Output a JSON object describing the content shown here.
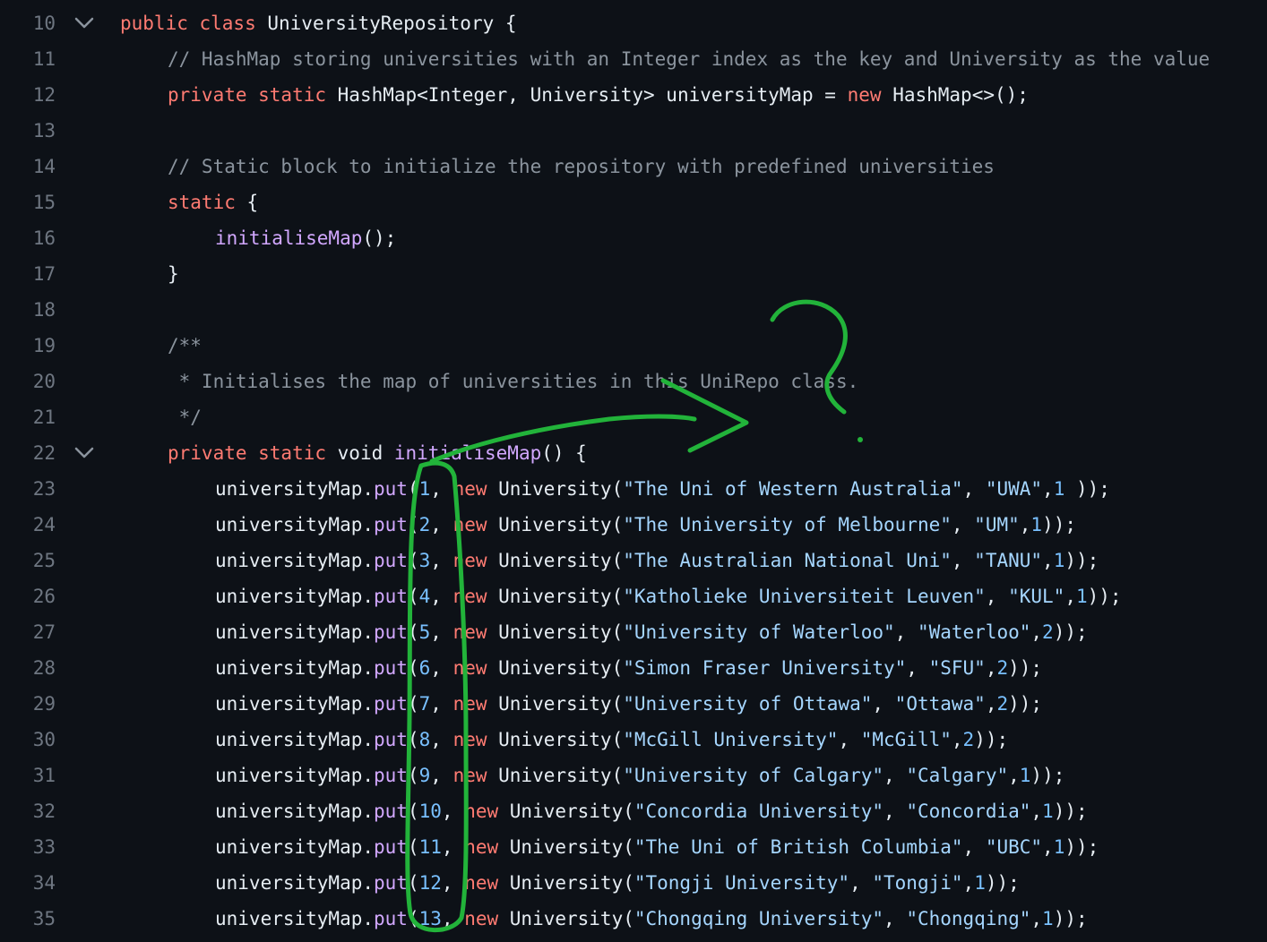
{
  "lines": [
    {
      "n": "10",
      "fold": true,
      "indent": 0,
      "tokens": [
        [
          "kw",
          "public class "
        ],
        [
          "pl",
          "UniversityRepository {"
        ]
      ]
    },
    {
      "n": "11",
      "indent": 1,
      "tokens": [
        [
          "cm",
          "// HashMap storing universities with an Integer index as the key and University as the value"
        ]
      ]
    },
    {
      "n": "12",
      "indent": 1,
      "tokens": [
        [
          "kw",
          "private static "
        ],
        [
          "pl",
          "HashMap<Integer, University> universityMap = "
        ],
        [
          "kw",
          "new "
        ],
        [
          "pl",
          "HashMap<>();"
        ]
      ]
    },
    {
      "n": "13",
      "indent": 0,
      "tokens": []
    },
    {
      "n": "14",
      "indent": 1,
      "tokens": [
        [
          "cm",
          "// Static block to initialize the repository with predefined universities"
        ]
      ]
    },
    {
      "n": "15",
      "indent": 1,
      "tokens": [
        [
          "kw",
          "static "
        ],
        [
          "pl",
          "{"
        ]
      ]
    },
    {
      "n": "16",
      "indent": 2,
      "tokens": [
        [
          "fn",
          "initialiseMap"
        ],
        [
          "pl",
          "();"
        ]
      ]
    },
    {
      "n": "17",
      "indent": 1,
      "tokens": [
        [
          "pl",
          "}"
        ]
      ]
    },
    {
      "n": "18",
      "indent": 0,
      "tokens": []
    },
    {
      "n": "19",
      "indent": 1,
      "tokens": [
        [
          "cm",
          "/**"
        ]
      ]
    },
    {
      "n": "20",
      "indent": 1,
      "tokens": [
        [
          "cm",
          " * Initialises the map of universities in this UniRepo class."
        ]
      ]
    },
    {
      "n": "21",
      "indent": 1,
      "tokens": [
        [
          "cm",
          " */"
        ]
      ]
    },
    {
      "n": "22",
      "fold": true,
      "indent": 1,
      "tokens": [
        [
          "kw",
          "private static "
        ],
        [
          "pl",
          "void "
        ],
        [
          "fn",
          "initialiseMap"
        ],
        [
          "pl",
          "() {"
        ]
      ]
    },
    {
      "n": "23",
      "indent": 2,
      "tokens": [
        [
          "pl",
          "universityMap."
        ],
        [
          "fn",
          "put"
        ],
        [
          "pl",
          "("
        ],
        [
          "nm",
          "1"
        ],
        [
          "pl",
          ", "
        ],
        [
          "kw",
          "new "
        ],
        [
          "pl",
          "University("
        ],
        [
          "st",
          "\"The Uni of Western Australia\""
        ],
        [
          "pl",
          ", "
        ],
        [
          "st",
          "\"UWA\""
        ],
        [
          "pl",
          ","
        ],
        [
          "nm",
          "1"
        ],
        [
          "pl",
          " ));"
        ]
      ]
    },
    {
      "n": "24",
      "indent": 2,
      "tokens": [
        [
          "pl",
          "universityMap."
        ],
        [
          "fn",
          "put"
        ],
        [
          "pl",
          "("
        ],
        [
          "nm",
          "2"
        ],
        [
          "pl",
          ", "
        ],
        [
          "kw",
          "new "
        ],
        [
          "pl",
          "University("
        ],
        [
          "st",
          "\"The University of Melbourne\""
        ],
        [
          "pl",
          ", "
        ],
        [
          "st",
          "\"UM\""
        ],
        [
          "pl",
          ","
        ],
        [
          "nm",
          "1"
        ],
        [
          "pl",
          "));"
        ]
      ]
    },
    {
      "n": "25",
      "indent": 2,
      "tokens": [
        [
          "pl",
          "universityMap."
        ],
        [
          "fn",
          "put"
        ],
        [
          "pl",
          "("
        ],
        [
          "nm",
          "3"
        ],
        [
          "pl",
          ", "
        ],
        [
          "kw",
          "new "
        ],
        [
          "pl",
          "University("
        ],
        [
          "st",
          "\"The Australian National Uni\""
        ],
        [
          "pl",
          ", "
        ],
        [
          "st",
          "\"TANU\""
        ],
        [
          "pl",
          ","
        ],
        [
          "nm",
          "1"
        ],
        [
          "pl",
          "));"
        ]
      ]
    },
    {
      "n": "26",
      "indent": 2,
      "tokens": [
        [
          "pl",
          "universityMap."
        ],
        [
          "fn",
          "put"
        ],
        [
          "pl",
          "("
        ],
        [
          "nm",
          "4"
        ],
        [
          "pl",
          ", "
        ],
        [
          "kw",
          "new "
        ],
        [
          "pl",
          "University("
        ],
        [
          "st",
          "\"Katholieke Universiteit Leuven\""
        ],
        [
          "pl",
          ", "
        ],
        [
          "st",
          "\"KUL\""
        ],
        [
          "pl",
          ","
        ],
        [
          "nm",
          "1"
        ],
        [
          "pl",
          "));"
        ]
      ]
    },
    {
      "n": "27",
      "indent": 2,
      "tokens": [
        [
          "pl",
          "universityMap."
        ],
        [
          "fn",
          "put"
        ],
        [
          "pl",
          "("
        ],
        [
          "nm",
          "5"
        ],
        [
          "pl",
          ", "
        ],
        [
          "kw",
          "new "
        ],
        [
          "pl",
          "University("
        ],
        [
          "st",
          "\"University of Waterloo\""
        ],
        [
          "pl",
          ", "
        ],
        [
          "st",
          "\"Waterloo\""
        ],
        [
          "pl",
          ","
        ],
        [
          "nm",
          "2"
        ],
        [
          "pl",
          "));"
        ]
      ]
    },
    {
      "n": "28",
      "indent": 2,
      "tokens": [
        [
          "pl",
          "universityMap."
        ],
        [
          "fn",
          "put"
        ],
        [
          "pl",
          "("
        ],
        [
          "nm",
          "6"
        ],
        [
          "pl",
          ", "
        ],
        [
          "kw",
          "new "
        ],
        [
          "pl",
          "University("
        ],
        [
          "st",
          "\"Simon Fraser University\""
        ],
        [
          "pl",
          ", "
        ],
        [
          "st",
          "\"SFU\""
        ],
        [
          "pl",
          ","
        ],
        [
          "nm",
          "2"
        ],
        [
          "pl",
          "));"
        ]
      ]
    },
    {
      "n": "29",
      "indent": 2,
      "tokens": [
        [
          "pl",
          "universityMap."
        ],
        [
          "fn",
          "put"
        ],
        [
          "pl",
          "("
        ],
        [
          "nm",
          "7"
        ],
        [
          "pl",
          ", "
        ],
        [
          "kw",
          "new "
        ],
        [
          "pl",
          "University("
        ],
        [
          "st",
          "\"University of Ottawa\""
        ],
        [
          "pl",
          ", "
        ],
        [
          "st",
          "\"Ottawa\""
        ],
        [
          "pl",
          ","
        ],
        [
          "nm",
          "2"
        ],
        [
          "pl",
          "));"
        ]
      ]
    },
    {
      "n": "30",
      "indent": 2,
      "tokens": [
        [
          "pl",
          "universityMap."
        ],
        [
          "fn",
          "put"
        ],
        [
          "pl",
          "("
        ],
        [
          "nm",
          "8"
        ],
        [
          "pl",
          ", "
        ],
        [
          "kw",
          "new "
        ],
        [
          "pl",
          "University("
        ],
        [
          "st",
          "\"McGill University\""
        ],
        [
          "pl",
          ", "
        ],
        [
          "st",
          "\"McGill\""
        ],
        [
          "pl",
          ","
        ],
        [
          "nm",
          "2"
        ],
        [
          "pl",
          "));"
        ]
      ]
    },
    {
      "n": "31",
      "indent": 2,
      "tokens": [
        [
          "pl",
          "universityMap."
        ],
        [
          "fn",
          "put"
        ],
        [
          "pl",
          "("
        ],
        [
          "nm",
          "9"
        ],
        [
          "pl",
          ", "
        ],
        [
          "kw",
          "new "
        ],
        [
          "pl",
          "University("
        ],
        [
          "st",
          "\"University of Calgary\""
        ],
        [
          "pl",
          ", "
        ],
        [
          "st",
          "\"Calgary\""
        ],
        [
          "pl",
          ","
        ],
        [
          "nm",
          "1"
        ],
        [
          "pl",
          "));"
        ]
      ]
    },
    {
      "n": "32",
      "indent": 2,
      "tokens": [
        [
          "pl",
          "universityMap."
        ],
        [
          "fn",
          "put"
        ],
        [
          "pl",
          "("
        ],
        [
          "nm",
          "10"
        ],
        [
          "pl",
          ", "
        ],
        [
          "kw",
          "new "
        ],
        [
          "pl",
          "University("
        ],
        [
          "st",
          "\"Concordia University\""
        ],
        [
          "pl",
          ", "
        ],
        [
          "st",
          "\"Concordia\""
        ],
        [
          "pl",
          ","
        ],
        [
          "nm",
          "1"
        ],
        [
          "pl",
          "));"
        ]
      ]
    },
    {
      "n": "33",
      "indent": 2,
      "tokens": [
        [
          "pl",
          "universityMap."
        ],
        [
          "fn",
          "put"
        ],
        [
          "pl",
          "("
        ],
        [
          "nm",
          "11"
        ],
        [
          "pl",
          ", "
        ],
        [
          "kw",
          "new "
        ],
        [
          "pl",
          "University("
        ],
        [
          "st",
          "\"The Uni of British Columbia\""
        ],
        [
          "pl",
          ", "
        ],
        [
          "st",
          "\"UBC\""
        ],
        [
          "pl",
          ","
        ],
        [
          "nm",
          "1"
        ],
        [
          "pl",
          "));"
        ]
      ]
    },
    {
      "n": "34",
      "indent": 2,
      "tokens": [
        [
          "pl",
          "universityMap."
        ],
        [
          "fn",
          "put"
        ],
        [
          "pl",
          "("
        ],
        [
          "nm",
          "12"
        ],
        [
          "pl",
          ", "
        ],
        [
          "kw",
          "new "
        ],
        [
          "pl",
          "University("
        ],
        [
          "st",
          "\"Tongji University\""
        ],
        [
          "pl",
          ", "
        ],
        [
          "st",
          "\"Tongji\""
        ],
        [
          "pl",
          ","
        ],
        [
          "nm",
          "1"
        ],
        [
          "pl",
          "));"
        ]
      ]
    },
    {
      "n": "35",
      "indent": 2,
      "tokens": [
        [
          "pl",
          "universityMap."
        ],
        [
          "fn",
          "put"
        ],
        [
          "pl",
          "("
        ],
        [
          "nm",
          "13"
        ],
        [
          "pl",
          ", "
        ],
        [
          "kw",
          "new "
        ],
        [
          "pl",
          "University("
        ],
        [
          "st",
          "\"Chongqing University\""
        ],
        [
          "pl",
          ", "
        ],
        [
          "st",
          "\"Chongqing\""
        ],
        [
          "pl",
          ","
        ],
        [
          "nm",
          "1"
        ],
        [
          "pl",
          "));"
        ]
      ]
    }
  ],
  "colors": {
    "background": "#0d1117",
    "line_number": "#6e7681",
    "keyword": "#ff7b72",
    "comment": "#8b949e",
    "string": "#a5d6ff",
    "number": "#79c0ff",
    "function": "#d2a8ff",
    "plain": "#e6edf3",
    "annotation": "#22b33a"
  },
  "icons": {
    "fold": "chevron-down-icon"
  }
}
